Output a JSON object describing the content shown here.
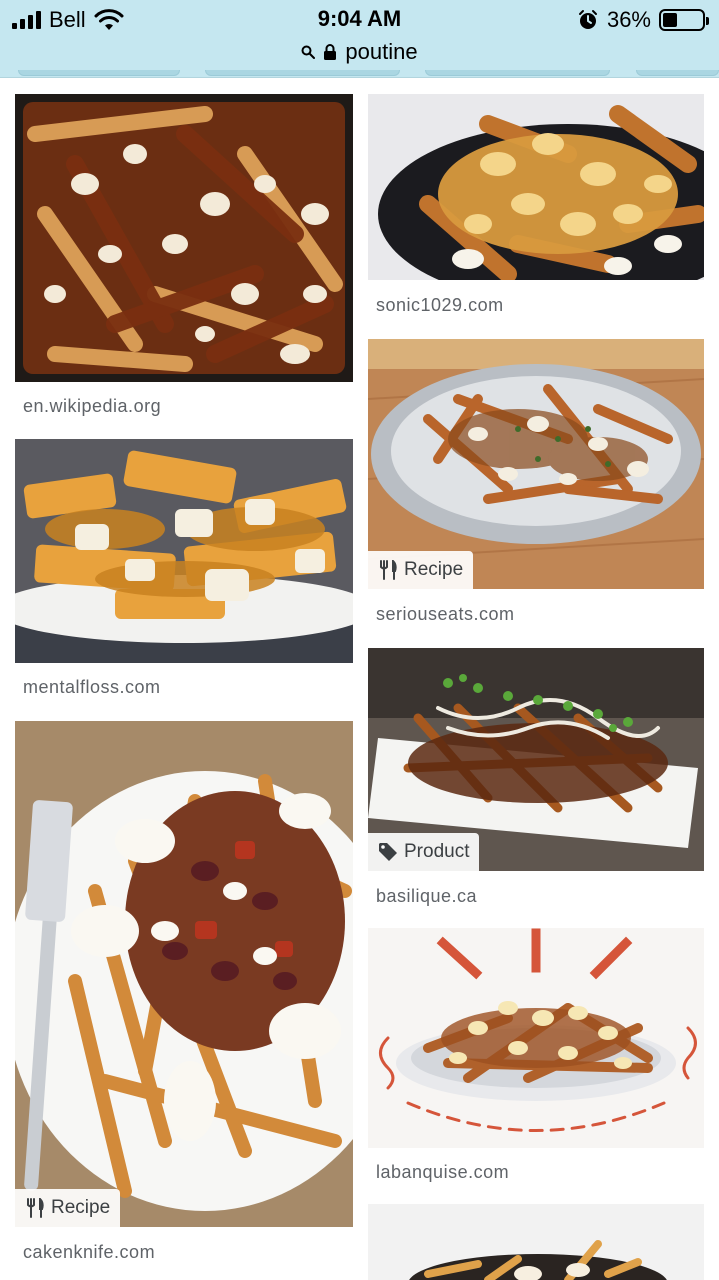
{
  "status_bar": {
    "carrier": "Bell",
    "time": "9:04 AM",
    "battery_percent": "36%",
    "battery_level": 0.36,
    "icons": [
      "signal-icon",
      "wifi-icon",
      "alarm-icon",
      "battery-icon"
    ]
  },
  "url_bar": {
    "query": "poutine",
    "icons": [
      "search-icon",
      "lock-icon"
    ]
  },
  "results": [
    {
      "source": "en.wikipedia.org",
      "badge": ""
    },
    {
      "source": "sonic1029.com",
      "badge": ""
    },
    {
      "source": "mentalfloss.com",
      "badge": ""
    },
    {
      "source": "seriouseats.com",
      "badge": "Recipe",
      "badge_icon": "fork-knife-icon"
    },
    {
      "source": "basilique.ca",
      "badge": "Product",
      "badge_icon": "tag-icon"
    },
    {
      "source": "cakenknife.com",
      "badge": "Recipe",
      "badge_icon": "fork-knife-icon"
    },
    {
      "source": "labanquise.com",
      "badge": ""
    }
  ],
  "colors": {
    "url_bar_background": "#c5e7f0",
    "source_text": "#5f6368"
  }
}
